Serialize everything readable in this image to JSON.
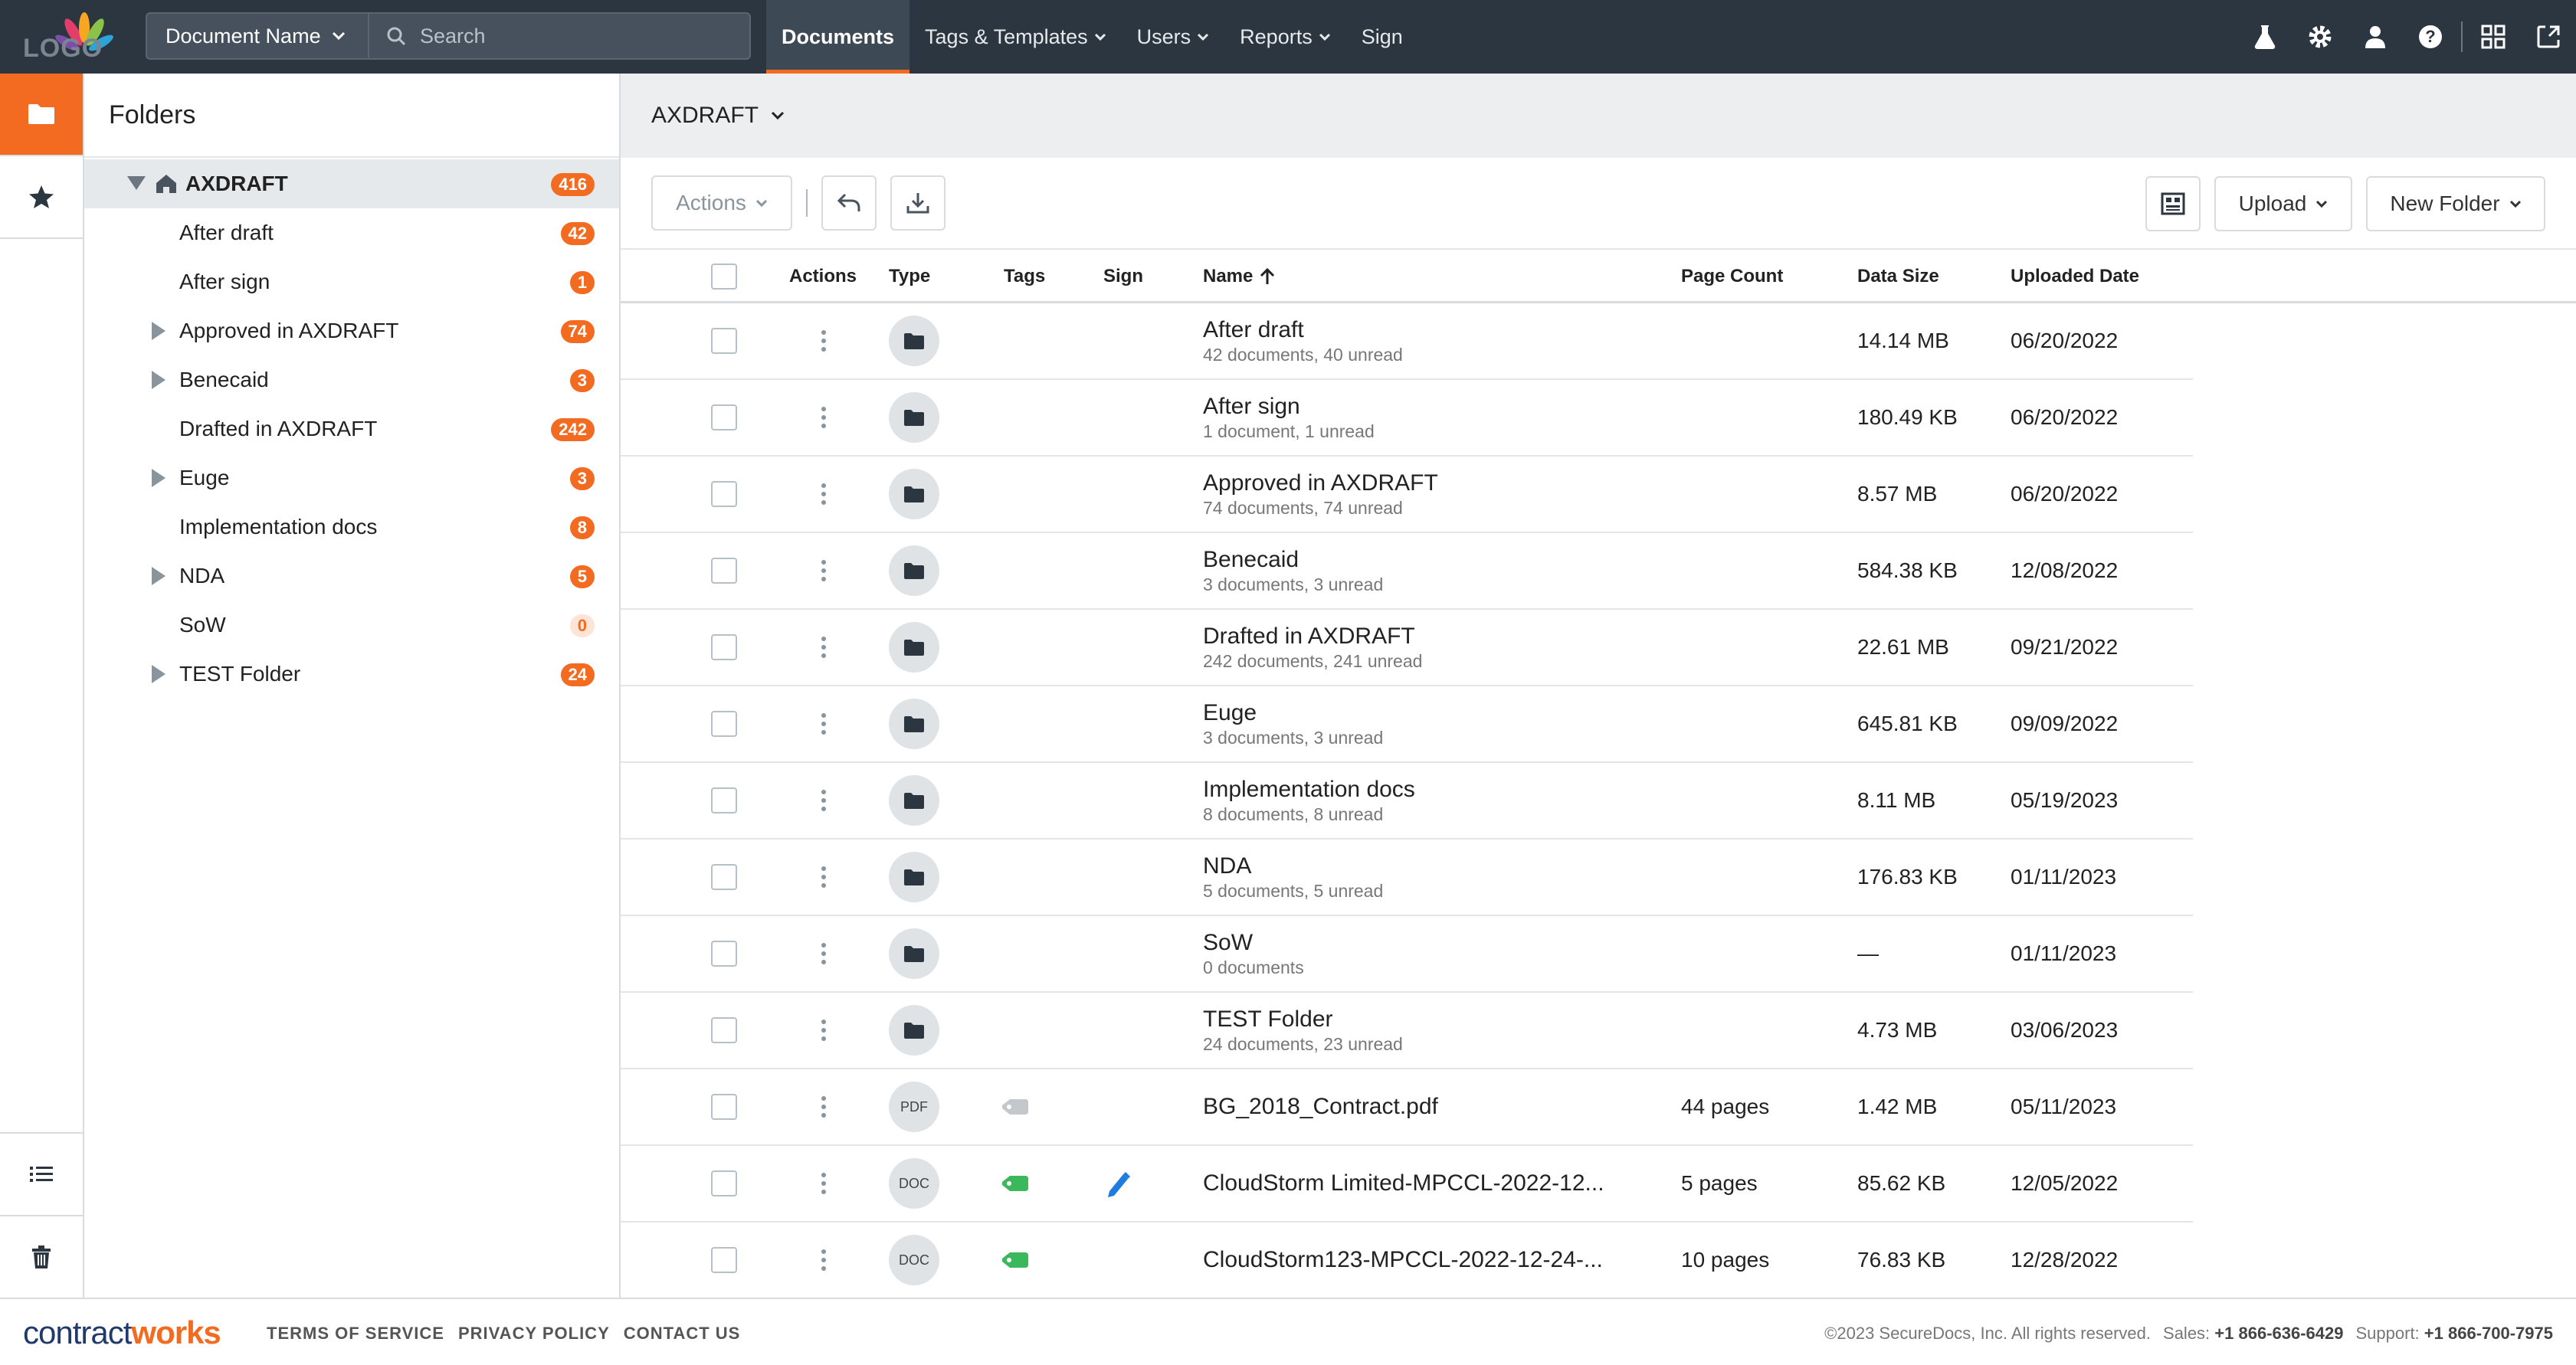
{
  "topbar": {
    "logo_text": "LOGO",
    "doc_name_label": "Document Name",
    "search_placeholder": "Search",
    "nav": [
      {
        "label": "Documents",
        "active": true
      },
      {
        "label": "Tags & Templates",
        "dropdown": true
      },
      {
        "label": "Users",
        "dropdown": true
      },
      {
        "label": "Reports",
        "dropdown": true
      },
      {
        "label": "Sign"
      }
    ],
    "icons": [
      "flask-icon",
      "gear-icon",
      "user-icon",
      "help-icon",
      "apps-grid-icon",
      "expand-icon"
    ]
  },
  "rail": {
    "items": [
      "folder-icon",
      "star-icon"
    ],
    "bottom_items": [
      "list-icon",
      "trash-icon"
    ]
  },
  "folders": {
    "title": "Folders",
    "root": {
      "label": "AXDRAFT",
      "count": "416"
    },
    "items": [
      {
        "label": "After draft",
        "count": "42",
        "expandable": false
      },
      {
        "label": "After sign",
        "count": "1",
        "expandable": false
      },
      {
        "label": "Approved in AXDRAFT",
        "count": "74",
        "expandable": true
      },
      {
        "label": "Benecaid",
        "count": "3",
        "expandable": true
      },
      {
        "label": "Drafted in AXDRAFT",
        "count": "242",
        "expandable": false
      },
      {
        "label": "Euge",
        "count": "3",
        "expandable": true
      },
      {
        "label": "Implementation docs",
        "count": "8",
        "expandable": false
      },
      {
        "label": "NDA",
        "count": "5",
        "expandable": true
      },
      {
        "label": "SoW",
        "count": "0",
        "expandable": false
      },
      {
        "label": "TEST Folder",
        "count": "24",
        "expandable": true
      }
    ]
  },
  "main": {
    "breadcrumb": "AXDRAFT",
    "toolbar": {
      "actions_label": "Actions",
      "upload_label": "Upload",
      "new_folder_label": "New Folder"
    },
    "columns": {
      "actions": "Actions",
      "type": "Type",
      "tags": "Tags",
      "sign": "Sign",
      "name": "Name",
      "page_count": "Page Count",
      "data_size": "Data Size",
      "uploaded_date": "Uploaded Date"
    },
    "rows": [
      {
        "type": "folder",
        "name": "After draft",
        "sub": "42 documents, 40 unread",
        "pages": "",
        "size": "14.14 MB",
        "date": "06/20/2022",
        "tag": false,
        "sign": false
      },
      {
        "type": "folder",
        "name": "After sign",
        "sub": "1 document, 1 unread",
        "pages": "",
        "size": "180.49 KB",
        "date": "06/20/2022",
        "tag": false,
        "sign": false
      },
      {
        "type": "folder",
        "name": "Approved in AXDRAFT",
        "sub": "74 documents, 74 unread",
        "pages": "",
        "size": "8.57 MB",
        "date": "06/20/2022",
        "tag": false,
        "sign": false
      },
      {
        "type": "folder",
        "name": "Benecaid",
        "sub": "3 documents, 3 unread",
        "pages": "",
        "size": "584.38 KB",
        "date": "12/08/2022",
        "tag": false,
        "sign": false
      },
      {
        "type": "folder",
        "name": "Drafted in AXDRAFT",
        "sub": "242 documents, 241 unread",
        "pages": "",
        "size": "22.61 MB",
        "date": "09/21/2022",
        "tag": false,
        "sign": false
      },
      {
        "type": "folder",
        "name": "Euge",
        "sub": "3 documents, 3 unread",
        "pages": "",
        "size": "645.81 KB",
        "date": "09/09/2022",
        "tag": false,
        "sign": false
      },
      {
        "type": "folder",
        "name": "Implementation docs",
        "sub": "8 documents, 8 unread",
        "pages": "",
        "size": "8.11 MB",
        "date": "05/19/2023",
        "tag": false,
        "sign": false
      },
      {
        "type": "folder",
        "name": "NDA",
        "sub": "5 documents, 5 unread",
        "pages": "",
        "size": "176.83 KB",
        "date": "01/11/2023",
        "tag": false,
        "sign": false
      },
      {
        "type": "folder",
        "name": "SoW",
        "sub": "0 documents",
        "pages": "",
        "size": "—",
        "date": "01/11/2023",
        "tag": false,
        "sign": false
      },
      {
        "type": "folder",
        "name": "TEST Folder",
        "sub": "24 documents, 23 unread",
        "pages": "",
        "size": "4.73 MB",
        "date": "03/06/2023",
        "tag": false,
        "sign": false
      },
      {
        "type": "PDF",
        "name": "BG_2018_Contract.pdf",
        "sub": "",
        "pages": "44 pages",
        "size": "1.42 MB",
        "date": "05/11/2023",
        "tag": "gray",
        "sign": false
      },
      {
        "type": "DOC",
        "name": "CloudStorm Limited-MPCCL-2022-12...",
        "sub": "",
        "pages": "5 pages",
        "size": "85.62 KB",
        "date": "12/05/2022",
        "tag": "green",
        "sign": true
      },
      {
        "type": "DOC",
        "name": "CloudStorm123-MPCCL-2022-12-24-...",
        "sub": "",
        "pages": "10 pages",
        "size": "76.83 KB",
        "date": "12/28/2022",
        "tag": "green",
        "sign": false
      }
    ]
  },
  "footer": {
    "brand_a": "contract",
    "brand_b": "works",
    "links": [
      "TERMS OF SERVICE",
      "PRIVACY POLICY",
      "CONTACT US"
    ],
    "copyright": "©2023 SecureDocs, Inc. All rights reserved.",
    "sales_label": "Sales:",
    "sales_phone": "+1 866-636-6429",
    "support_label": "Support:",
    "support_phone": "+1 866-700-7975"
  },
  "colors": {
    "accent": "#f26b21",
    "topbar": "#2c3640",
    "tag_green": "#3cb85c",
    "tag_gray": "#c3c8cc",
    "sign_blue": "#1e7be0"
  }
}
